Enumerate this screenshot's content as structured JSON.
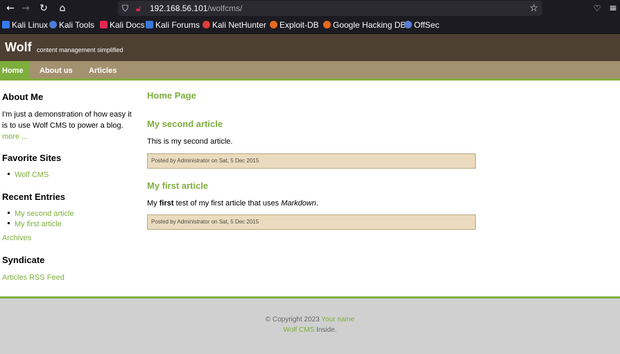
{
  "browser": {
    "url_host": "192.168.56.101",
    "url_path": "/wolfcms/",
    "bookmarks": [
      {
        "label": "Kali Linux",
        "icon": "kali-dragon-icon"
      },
      {
        "label": "Kali Tools",
        "icon": "kali-tools-icon"
      },
      {
        "label": "Kali Docs",
        "icon": "kali-docs-icon"
      },
      {
        "label": "Kali Forums",
        "icon": "kali-forums-icon"
      },
      {
        "label": "Kali NetHunter",
        "icon": "nethunter-icon"
      },
      {
        "label": "Exploit-DB",
        "icon": "exploit-db-icon"
      },
      {
        "label": "Google Hacking DB",
        "icon": "ghdb-icon"
      },
      {
        "label": "OffSec",
        "icon": "offsec-icon"
      }
    ]
  },
  "site": {
    "logo": "Wolf",
    "slogan": "content management simplified",
    "accent_color": "#7eae3d",
    "header_color": "#4d3f32",
    "menu_color": "#a39170"
  },
  "menu": [
    {
      "label": "Home",
      "active": true
    },
    {
      "label": "About us",
      "active": false
    },
    {
      "label": "Articles",
      "active": false
    }
  ],
  "sidebar": {
    "about_title": "About Me",
    "about_text": "I'm just a demonstration of how easy it is to use Wolf CMS to power a blog.",
    "about_more": "more ...",
    "favorites_title": "Favorite Sites",
    "favorites": [
      "Wolf CMS"
    ],
    "recent_title": "Recent Entries",
    "recent": [
      "My second article",
      "My first article"
    ],
    "archives": "Archives",
    "syndicate_title": "Syndicate",
    "rss": "Articles RSS Feed"
  },
  "main": {
    "page_title": "Home Page",
    "articles": [
      {
        "title": "My second article",
        "body": "This is my second article.",
        "meta": "Posted by Administrator on Sat, 5 Dec 2015"
      },
      {
        "title": "My first article",
        "body_prefix": "My ",
        "body_bold": "first",
        "body_middle": " test of my first article that uses ",
        "body_italic": "Markdown",
        "body_suffix": ".",
        "meta": "Posted by Administrator on Sat, 5 Dec 2015"
      }
    ]
  },
  "footer": {
    "copyright": "© Copyright 2023 ",
    "your_name": "Your name",
    "wolf_link": "Wolf CMS",
    "inside": " Inside."
  }
}
